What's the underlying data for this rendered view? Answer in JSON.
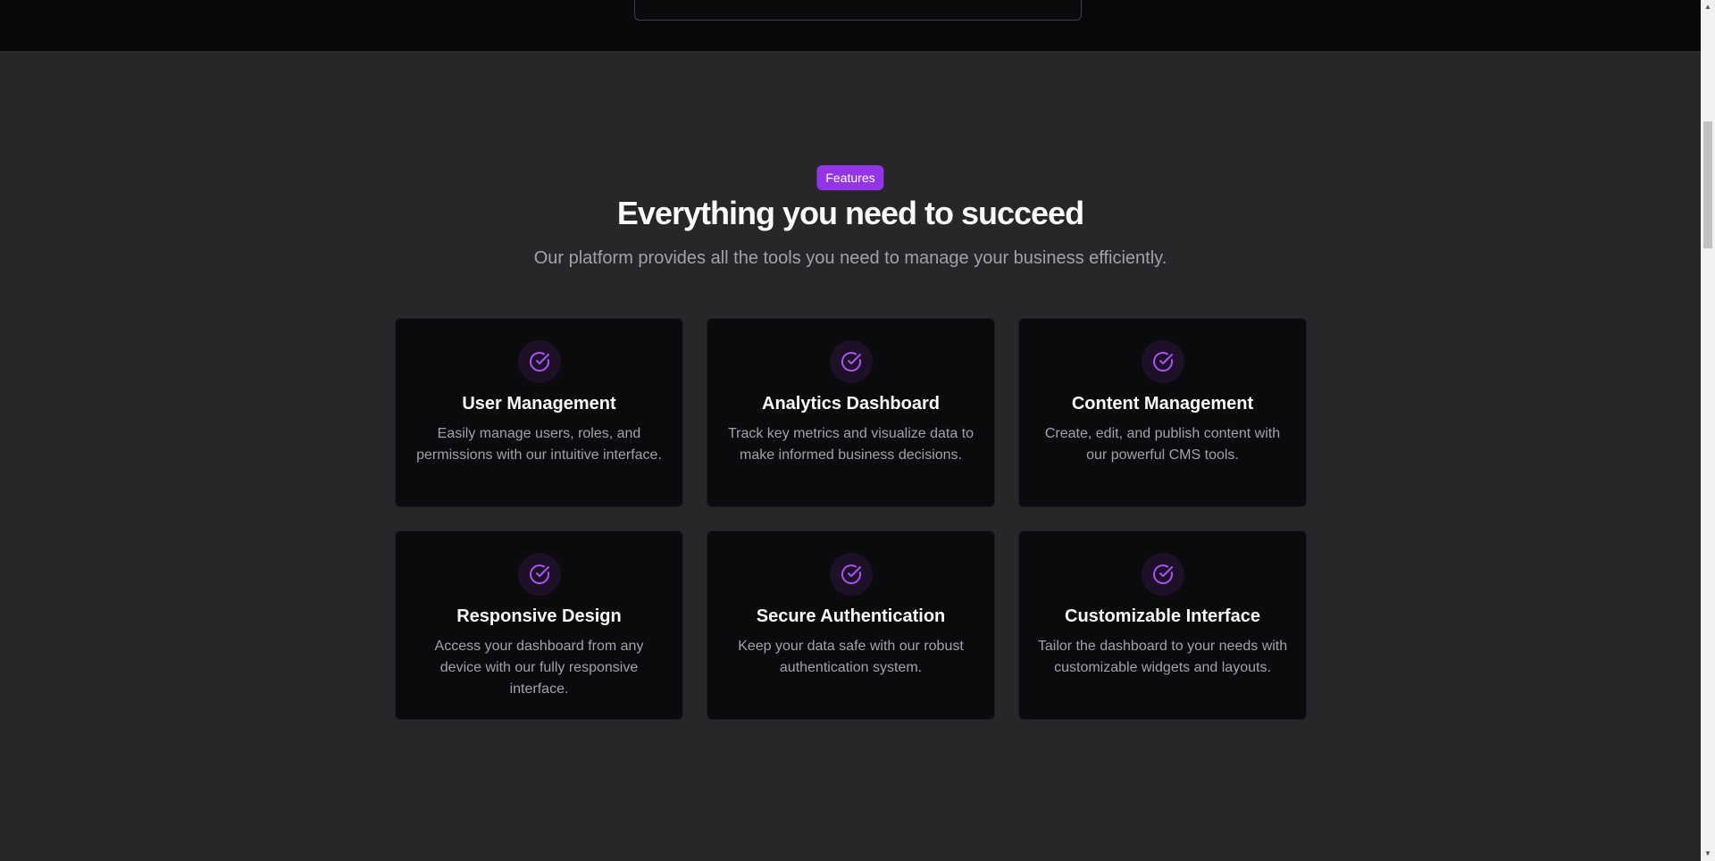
{
  "features": {
    "badge": "Features",
    "title": "Everything you need to succeed",
    "subtitle": "Our platform provides all the tools you need to manage your business efficiently.",
    "cards": [
      {
        "title": "User Management",
        "description": "Easily manage users, roles, and permissions with our intuitive interface.",
        "icon": "check-circle-icon"
      },
      {
        "title": "Analytics Dashboard",
        "description": "Track key metrics and visualize data to make informed business decisions.",
        "icon": "check-circle-icon"
      },
      {
        "title": "Content Management",
        "description": "Create, edit, and publish content with our powerful CMS tools.",
        "icon": "check-circle-icon"
      },
      {
        "title": "Responsive Design",
        "description": "Access your dashboard from any device with our fully responsive interface.",
        "icon": "check-circle-icon"
      },
      {
        "title": "Secure Authentication",
        "description": "Keep your data safe with our robust authentication system.",
        "icon": "check-circle-icon"
      },
      {
        "title": "Customizable Interface",
        "description": "Tailor the dashboard to your needs with customizable widgets and layouts.",
        "icon": "check-circle-icon"
      }
    ]
  },
  "colors": {
    "accent": "#9333ea",
    "icon_stroke": "#a855f7",
    "card_bg": "#0b0b0e",
    "section_bg": "#27272a",
    "top_bg": "#09090b"
  }
}
